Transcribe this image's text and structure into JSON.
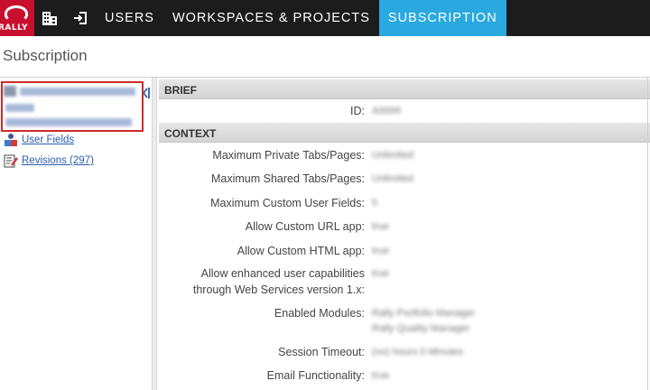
{
  "nav": {
    "logo_text": "RALLY",
    "tabs": [
      {
        "label": "USERS"
      },
      {
        "label": "WORKSPACES & PROJECTS"
      },
      {
        "label": "SUBSCRIPTION"
      }
    ],
    "active_color": "#29a9e0"
  },
  "page": {
    "title": "Subscription"
  },
  "sidebar": {
    "links": [
      {
        "label": "User Fields",
        "icon": "user-fields-icon"
      },
      {
        "label": "Revisions (297)",
        "icon": "revisions-icon"
      }
    ],
    "highlight_color": "#d12a2a"
  },
  "detail": {
    "sections": [
      {
        "title": "BRIEF"
      },
      {
        "title": "CONTEXT"
      }
    ],
    "brief": [
      {
        "label": "ID:",
        "value": "A9999"
      }
    ],
    "context": [
      {
        "label": "Maximum Private Tabs/Pages:",
        "value": "Unlimited"
      },
      {
        "label": "Maximum Shared Tabs/Pages:",
        "value": "Unlimited"
      },
      {
        "label": "Maximum Custom User Fields:",
        "value": "5"
      },
      {
        "label": "Allow Custom URL app:",
        "value": "true"
      },
      {
        "label": "Allow Custom HTML app:",
        "value": "true"
      },
      {
        "label": "Allow enhanced user capabilities",
        "label2": "through Web Services version 1.x:",
        "value": "true"
      },
      {
        "label": "Enabled Modules:",
        "value": "Rally Portfolio Manager",
        "value2": "Rally Quality Manager"
      },
      {
        "label": "Session Timeout:",
        "value": "(no) hours 0 Minutes"
      },
      {
        "label": "Email Functionality:",
        "value": "true"
      }
    ]
  }
}
